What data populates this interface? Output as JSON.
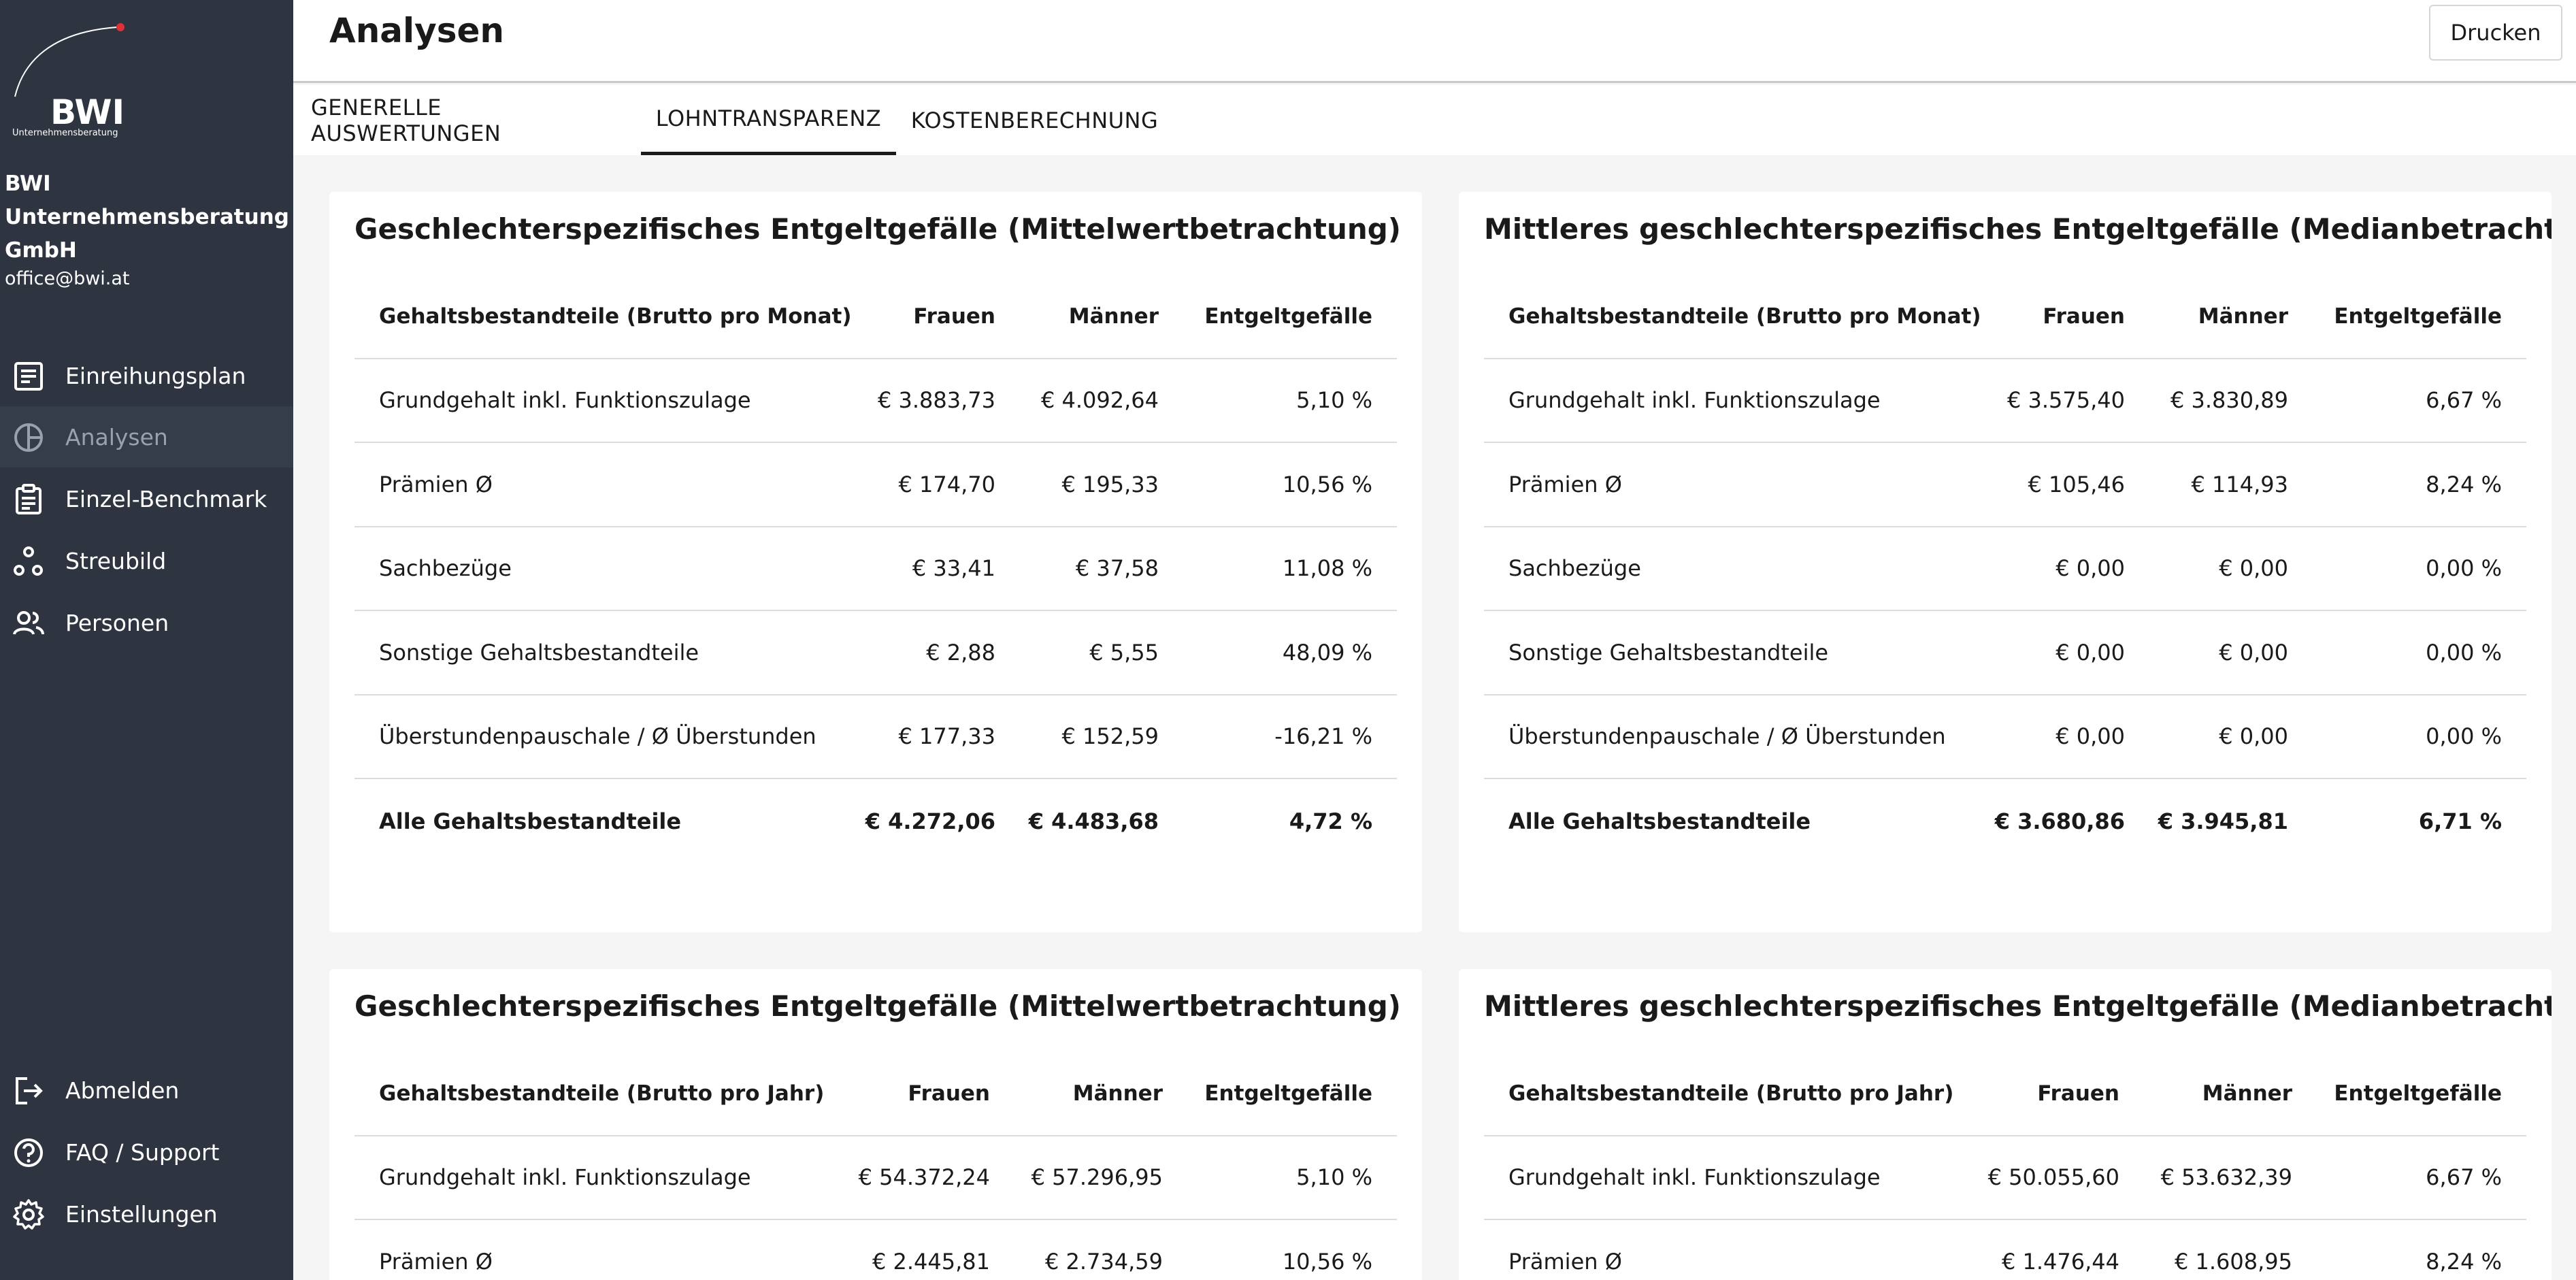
{
  "sidebar": {
    "logo_text": "BWI",
    "logo_subtext": "Unternehmensberatung",
    "company": "BWI Unternehmensberatung GmbH",
    "email": "office@bwi.at",
    "nav": [
      {
        "label": "Einreihungsplan",
        "icon": "list-icon"
      },
      {
        "label": "Analysen",
        "icon": "pie-chart-icon",
        "active": true
      },
      {
        "label": "Einzel-Benchmark",
        "icon": "clipboard-icon"
      },
      {
        "label": "Streubild",
        "icon": "scatter-icon"
      },
      {
        "label": "Personen",
        "icon": "people-icon"
      }
    ],
    "bottom_nav": [
      {
        "label": "Abmelden",
        "icon": "logout-icon"
      },
      {
        "label": "FAQ / Support",
        "icon": "help-icon"
      },
      {
        "label": "Einstellungen",
        "icon": "gear-icon"
      }
    ]
  },
  "header": {
    "title": "Analysen",
    "print_label": "Drucken"
  },
  "tabs": [
    {
      "label": "GENERELLE AUSWERTUNGEN"
    },
    {
      "label": "LOHNTRANSPARENZ",
      "active": true
    },
    {
      "label": "KOSTENBERECHNUNG"
    }
  ],
  "cards": [
    {
      "title": "Geschlechterspezifisches Entgeltgefälle (Mittelwertbetrachtung)",
      "headers": [
        "Gehaltsbestandteile (Brutto pro Monat)",
        "Frauen",
        "Männer",
        "Entgeltgefälle"
      ],
      "rows": [
        [
          "Grundgehalt inkl. Funktionszulage",
          "€ 3.883,73",
          "€ 4.092,64",
          "5,10 %"
        ],
        [
          "Prämien Ø",
          "€ 174,70",
          "€ 195,33",
          "10,56 %"
        ],
        [
          "Sachbezüge",
          "€ 33,41",
          "€ 37,58",
          "11,08 %"
        ],
        [
          "Sonstige Gehaltsbestandteile",
          "€ 2,88",
          "€ 5,55",
          "48,09 %"
        ],
        [
          "Überstundenpauschale / Ø Überstunden",
          "€ 177,33",
          "€ 152,59",
          "-16,21 %"
        ]
      ],
      "total": [
        "Alle Gehaltsbestandteile",
        "€ 4.272,06",
        "€ 4.483,68",
        "4,72 %"
      ]
    },
    {
      "title": "Mittleres geschlechterspezifisches Entgeltgefälle (Medianbetrachtung)",
      "headers": [
        "Gehaltsbestandteile (Brutto pro Monat)",
        "Frauen",
        "Männer",
        "Entgeltgefälle"
      ],
      "rows": [
        [
          "Grundgehalt inkl. Funktionszulage",
          "€ 3.575,40",
          "€ 3.830,89",
          "6,67 %"
        ],
        [
          "Prämien Ø",
          "€ 105,46",
          "€ 114,93",
          "8,24 %"
        ],
        [
          "Sachbezüge",
          "€ 0,00",
          "€ 0,00",
          "0,00 %"
        ],
        [
          "Sonstige Gehaltsbestandteile",
          "€ 0,00",
          "€ 0,00",
          "0,00 %"
        ],
        [
          "Überstundenpauschale / Ø Überstunden",
          "€ 0,00",
          "€ 0,00",
          "0,00 %"
        ]
      ],
      "total": [
        "Alle Gehaltsbestandteile",
        "€ 3.680,86",
        "€ 3.945,81",
        "6,71 %"
      ]
    },
    {
      "title": "Geschlechterspezifisches Entgeltgefälle (Mittelwertbetrachtung)",
      "headers": [
        "Gehaltsbestandteile (Brutto pro Jahr)",
        "Frauen",
        "Männer",
        "Entgeltgefälle"
      ],
      "rows": [
        [
          "Grundgehalt inkl. Funktionszulage",
          "€ 54.372,24",
          "€ 57.296,95",
          "5,10 %"
        ],
        [
          "Prämien Ø",
          "€ 2.445,81",
          "€ 2.734,59",
          "10,56 %"
        ]
      ]
    },
    {
      "title": "Mittleres geschlechterspezifisches Entgeltgefälle (Medianbetrachtung)",
      "headers": [
        "Gehaltsbestandteile (Brutto pro Jahr)",
        "Frauen",
        "Männer",
        "Entgeltgefälle"
      ],
      "rows": [
        [
          "Grundgehalt inkl. Funktionszulage",
          "€ 50.055,60",
          "€ 53.632,39",
          "6,67 %"
        ],
        [
          "Prämien Ø",
          "€ 1.476,44",
          "€ 1.608,95",
          "8,24 %"
        ]
      ]
    }
  ]
}
